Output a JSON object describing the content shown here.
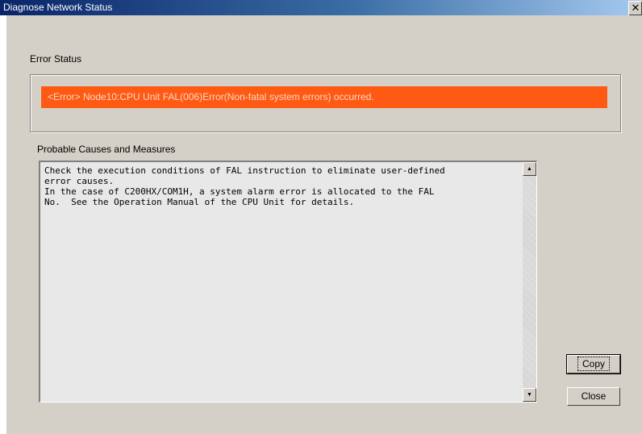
{
  "window": {
    "title": "Diagnose Network Status",
    "close_glyph": "✕"
  },
  "error_status": {
    "label": "Error Status",
    "message": "<Error> Node10:CPU Unit FAL(006)Error(Non-fatal system errors) occurred.",
    "highlight_color": "#ff5a14"
  },
  "causes": {
    "label": "Probable Causes and Measures",
    "text": "Check the execution conditions of FAL instruction to eliminate user-defined\nerror causes.\nIn the case of C200HX/COM1H, a system alarm error is allocated to the FAL\nNo.  See the Operation Manual of the CPU Unit for details."
  },
  "scrollbar": {
    "up_icon": "scroll-up-icon",
    "down_icon": "scroll-down-icon",
    "up_glyph": "▲",
    "down_glyph": "▼"
  },
  "buttons": {
    "copy_label": "Copy",
    "close_label": "Close"
  }
}
